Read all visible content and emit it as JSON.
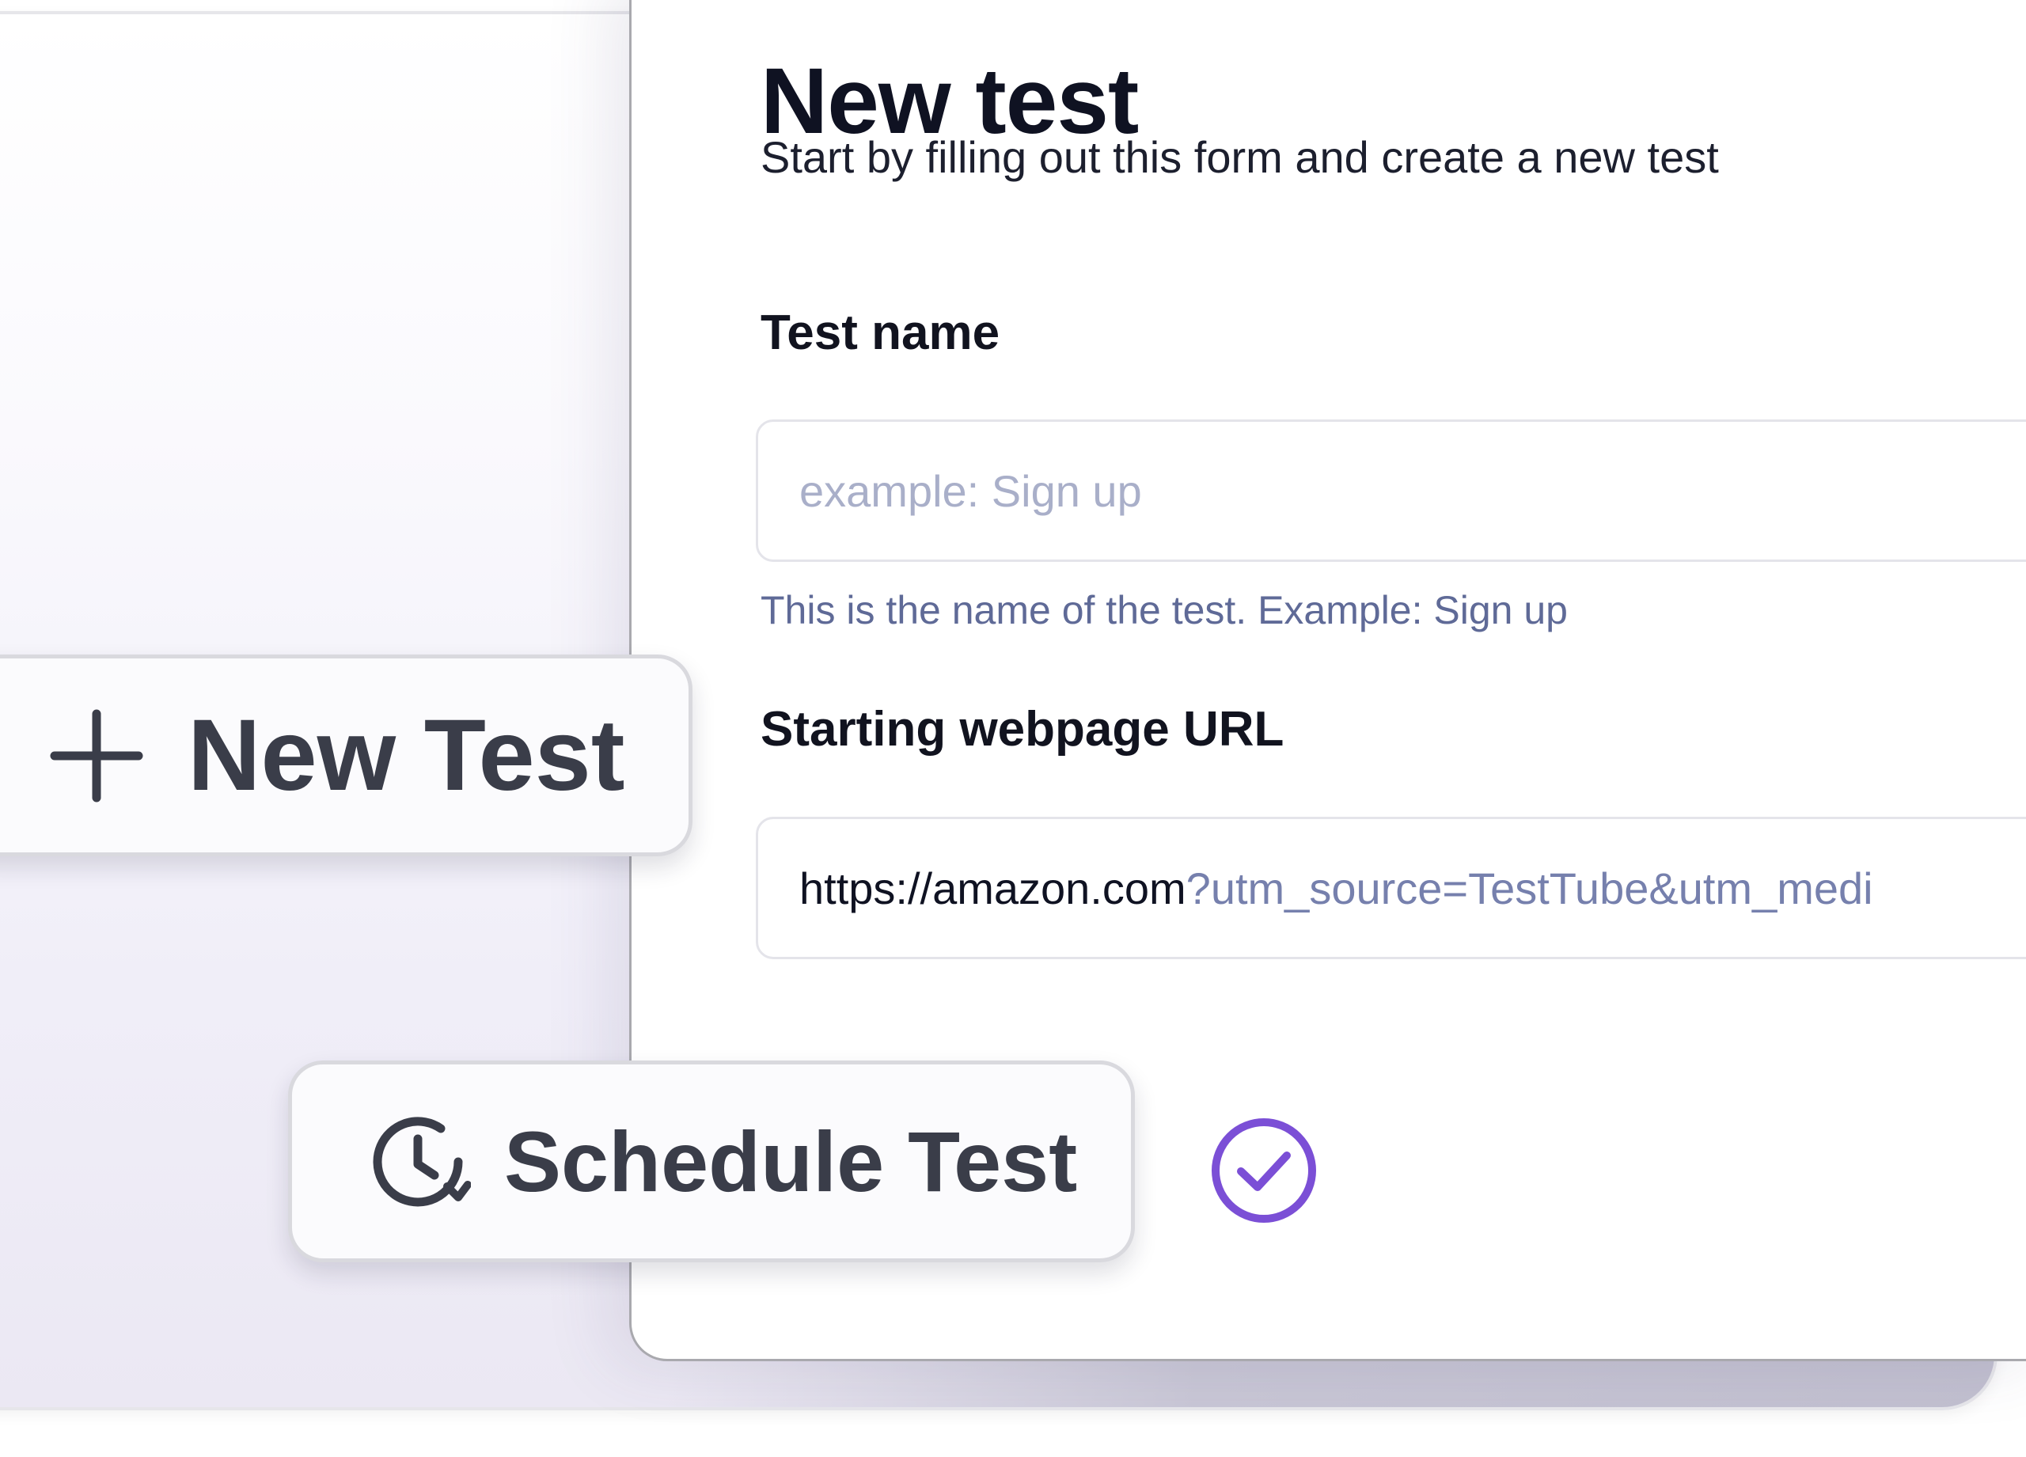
{
  "form": {
    "title": "New test",
    "subtitle": "Start by filling out this form and create a new test",
    "test_name": {
      "label": "Test name",
      "placeholder": "example: Sign up",
      "helper": "This is the name of the test. Example: Sign up"
    },
    "start_url": {
      "label": "Starting webpage URL",
      "value_base": "https://amazon.com",
      "value_query": "?utm_source=TestTube&utm_medi"
    }
  },
  "actions": {
    "new_test_label": "New Test",
    "new_test_icon": "plus-icon",
    "schedule_label": "Schedule Test",
    "schedule_icon": "clock-refresh-icon",
    "status_icon": "check-circle-icon"
  },
  "colors": {
    "accent": "#7b4fd6",
    "heading": "#0f1222",
    "helper_text": "#5f6a97",
    "url_query": "#7680ad",
    "placeholder": "#a9afc9",
    "button_text": "#3a3d49"
  }
}
